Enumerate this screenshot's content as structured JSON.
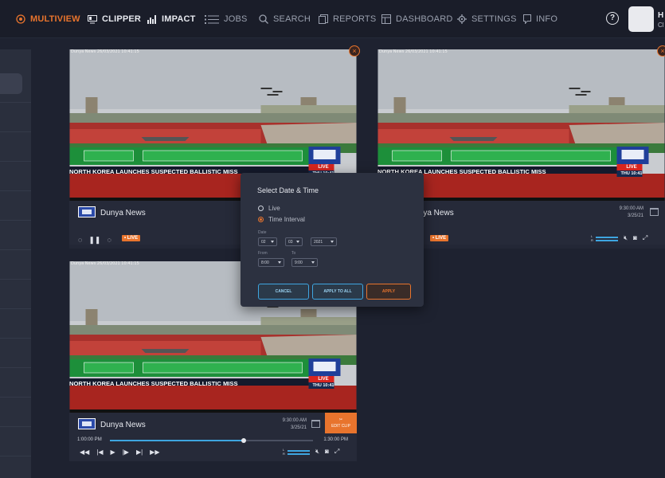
{
  "nav": {
    "items": [
      {
        "label": "MULTIVIEW",
        "icon": "multiview-icon"
      },
      {
        "label": "CLIPPER",
        "icon": "clipper-icon"
      },
      {
        "label": "IMPACT",
        "icon": "impact-icon"
      },
      {
        "label": "JOBS",
        "icon": "jobs-icon"
      },
      {
        "label": "SEARCH",
        "icon": "search-icon"
      },
      {
        "label": "REPORTS",
        "icon": "reports-icon"
      },
      {
        "label": "DASHBOARD",
        "icon": "dashboard-icon"
      },
      {
        "label": "SETTINGS",
        "icon": "settings-icon"
      },
      {
        "label": "INFO",
        "icon": "info-icon"
      }
    ],
    "help": "?",
    "user_initial": "H",
    "user_sub": "Cl"
  },
  "colors": {
    "accent": "#e8742d",
    "blue": "#3ea5e0",
    "bg": "#1e2230"
  },
  "tiles": [
    {
      "stamp": "Dunya News  26/03/2021 10:41:15",
      "headline": "NORTH KOREA LAUNCHES SUSPECTED BALLISTIC MISS",
      "live_tag": "LIVE",
      "clock": "THU 10:41",
      "channel": "Dunya News",
      "live_badge": "• LIVE"
    },
    {
      "stamp": "Dunya News  26/03/2021 10:41:15",
      "headline": "NORTH KOREA LAUNCHES SUSPECTED BALLISTIC MISS",
      "live_tag": "LIVE",
      "clock": "THU 10:41",
      "channel": "Dunya News",
      "time": "9:30:00 AM",
      "date": "3/25/21",
      "live_badge": "• LIVE"
    },
    {
      "stamp": "Dunya News  26/03/2021 10:41:15",
      "headline": "NORTH KOREA LAUNCHES SUSPECTED BALLISTIC MISS",
      "live_tag": "LIVE",
      "clock": "THU 10:41",
      "channel": "Dunya News",
      "time": "9:30:00 AM",
      "date": "3/25/21",
      "edit_clip": "EDIT CLIP",
      "start_time": "1:00:00 PM",
      "end_time": "1:30:00 PM",
      "progress": 0.66
    }
  ],
  "modal": {
    "title": "Select Date & Time",
    "opt_live": "Live",
    "opt_interval": "Time Interval",
    "date_label": "Date",
    "month": "02",
    "day": "03",
    "year": "2021",
    "from_label": "From",
    "to_label": "To",
    "from_value": "8:00",
    "to_value": "9:00",
    "cancel": "CANCEL",
    "apply_all": "APPLY TO ALL",
    "apply": "APPLY"
  }
}
